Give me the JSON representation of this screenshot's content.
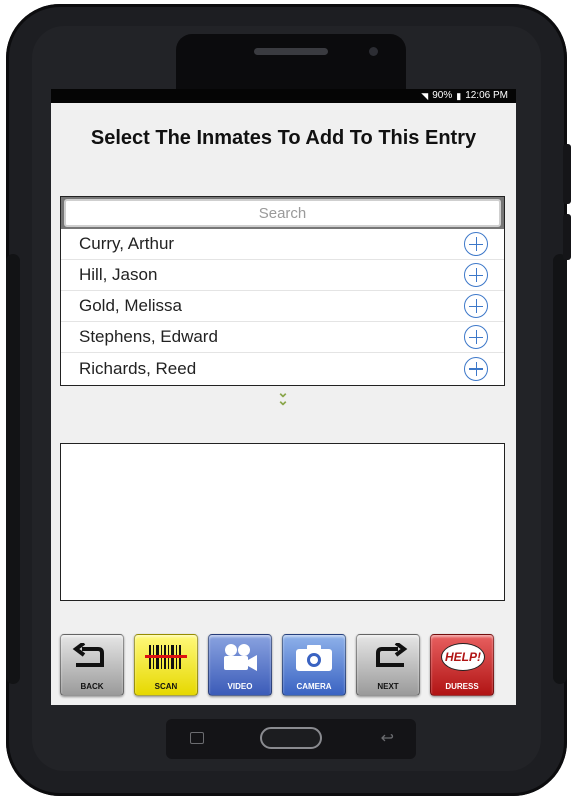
{
  "status_bar": {
    "wifi_icon": "wifi-icon",
    "battery_percent": "90%",
    "battery_icon": "battery-icon",
    "time": "12:06 PM"
  },
  "page": {
    "title": "Select The Inmates To Add To This Entry"
  },
  "search": {
    "placeholder": "Search",
    "value": ""
  },
  "inmates": [
    {
      "name": "Curry, Arthur"
    },
    {
      "name": "Hill, Jason"
    },
    {
      "name": "Gold, Melissa"
    },
    {
      "name": "Stephens, Edward"
    },
    {
      "name": "Richards, Reed"
    }
  ],
  "toolbar": {
    "back_label": "BACK",
    "scan_label": "SCAN",
    "video_label": "VIDEO",
    "camera_label": "CAMERA",
    "next_label": "NEXT",
    "duress_label": "DURESS",
    "help_text": "HELP!"
  },
  "colors": {
    "accent_blue": "#3d78c9",
    "chevron_green": "#8aa64a",
    "scan_yellow": "#f2e600",
    "duress_red": "#c81e1e"
  }
}
